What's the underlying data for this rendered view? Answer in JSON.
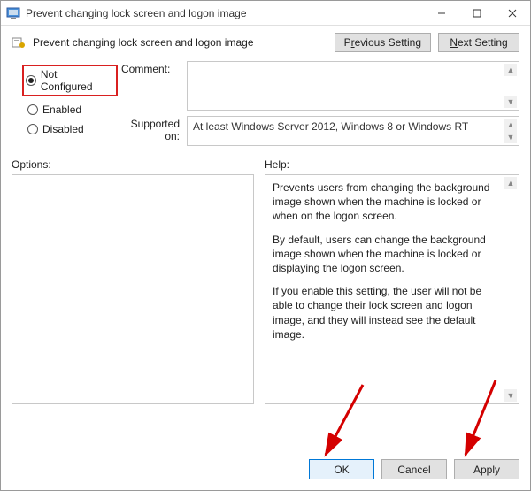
{
  "titlebar": {
    "title": "Prevent changing lock screen and logon image"
  },
  "toolbar": {
    "heading": "Prevent changing lock screen and logon image",
    "previous_pre": "P",
    "previous_mid": "r",
    "previous_post": "evious Setting",
    "next_pre": "",
    "next_mid": "N",
    "next_post": "ext Setting"
  },
  "radios": {
    "not_configured_pre": "Not ",
    "not_configured_mid": "C",
    "not_configured_post": "onfigured",
    "enabled_mid": "E",
    "enabled_post": "nabled",
    "disabled_mid": "D",
    "disabled_post": "isabled"
  },
  "labels": {
    "comment": "Comment:",
    "supported": "Supported on:",
    "options": "Options:",
    "help": "Help:"
  },
  "supported_text": "At least Windows Server 2012, Windows 8 or Windows RT",
  "help": {
    "p1": "Prevents users from changing the background image shown when the machine is locked or when on the logon screen.",
    "p2": "By default, users can change the background image shown when the machine is locked or displaying the logon screen.",
    "p3": "If you enable this setting, the user will not be able to change their lock screen and logon image, and they will instead see the default image."
  },
  "buttons": {
    "ok": "OK",
    "cancel": "Cancel",
    "apply_mid": "A",
    "apply_post": "pply"
  }
}
